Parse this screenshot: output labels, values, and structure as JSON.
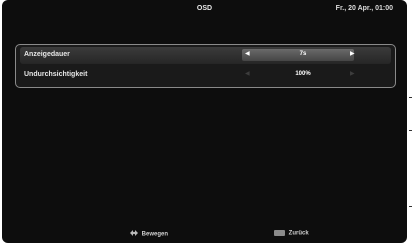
{
  "header": {
    "title": "OSD",
    "clock": "Fr., 20 Apr., 01:00"
  },
  "settings": [
    {
      "label": "Anzeigedauer",
      "value": "7s",
      "selected": true
    },
    {
      "label": "Undurchsichtigkeit",
      "value": "100%",
      "selected": false
    }
  ],
  "footer": {
    "move_label": "Bewegen",
    "back_label": "Zurück"
  },
  "icons": {
    "move": "directional-pad-icon",
    "back": "back-button-icon",
    "left_arrow": "triangle-left",
    "right_arrow": "triangle-right"
  },
  "colors": {
    "background": "#0d0d0d",
    "selected_row": "#333333",
    "text": "#e6e6e6"
  }
}
